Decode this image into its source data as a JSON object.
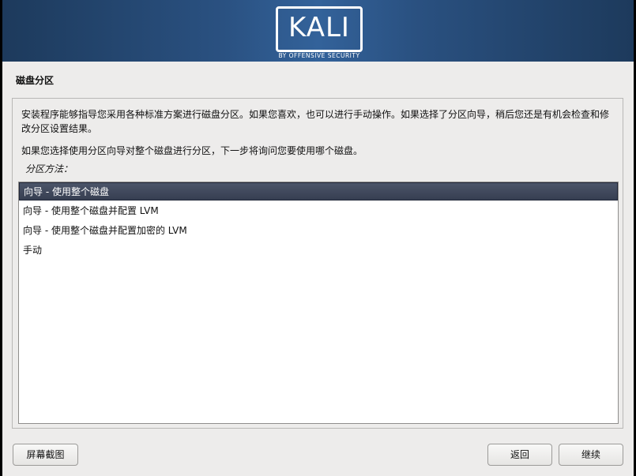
{
  "banner": {
    "logo_text": "KALI",
    "logo_subtitle": "BY OFFENSIVE SECURITY"
  },
  "page": {
    "title": "磁盘分区",
    "description": "安装程序能够指导您采用各种标准方案进行磁盘分区。如果您喜欢，也可以进行手动操作。如果选择了分区向导，稍后您还是有机会检查和修改分区设置结果。",
    "description2": "如果您选择使用分区向导对整个磁盘进行分区，下一步将询问您要使用哪个磁盘。",
    "method_label": "分区方法："
  },
  "options": [
    {
      "label": "向导 - 使用整个磁盘",
      "selected": true
    },
    {
      "label": "向导 - 使用整个磁盘并配置 LVM",
      "selected": false
    },
    {
      "label": "向导 - 使用整个磁盘并配置加密的 LVM",
      "selected": false
    },
    {
      "label": "手动",
      "selected": false
    }
  ],
  "buttons": {
    "screenshot": "屏幕截图",
    "back": "返回",
    "continue": "继续"
  },
  "colors": {
    "banner": "#2a5181",
    "selection": "#3f4759",
    "background": "#edeceb"
  }
}
